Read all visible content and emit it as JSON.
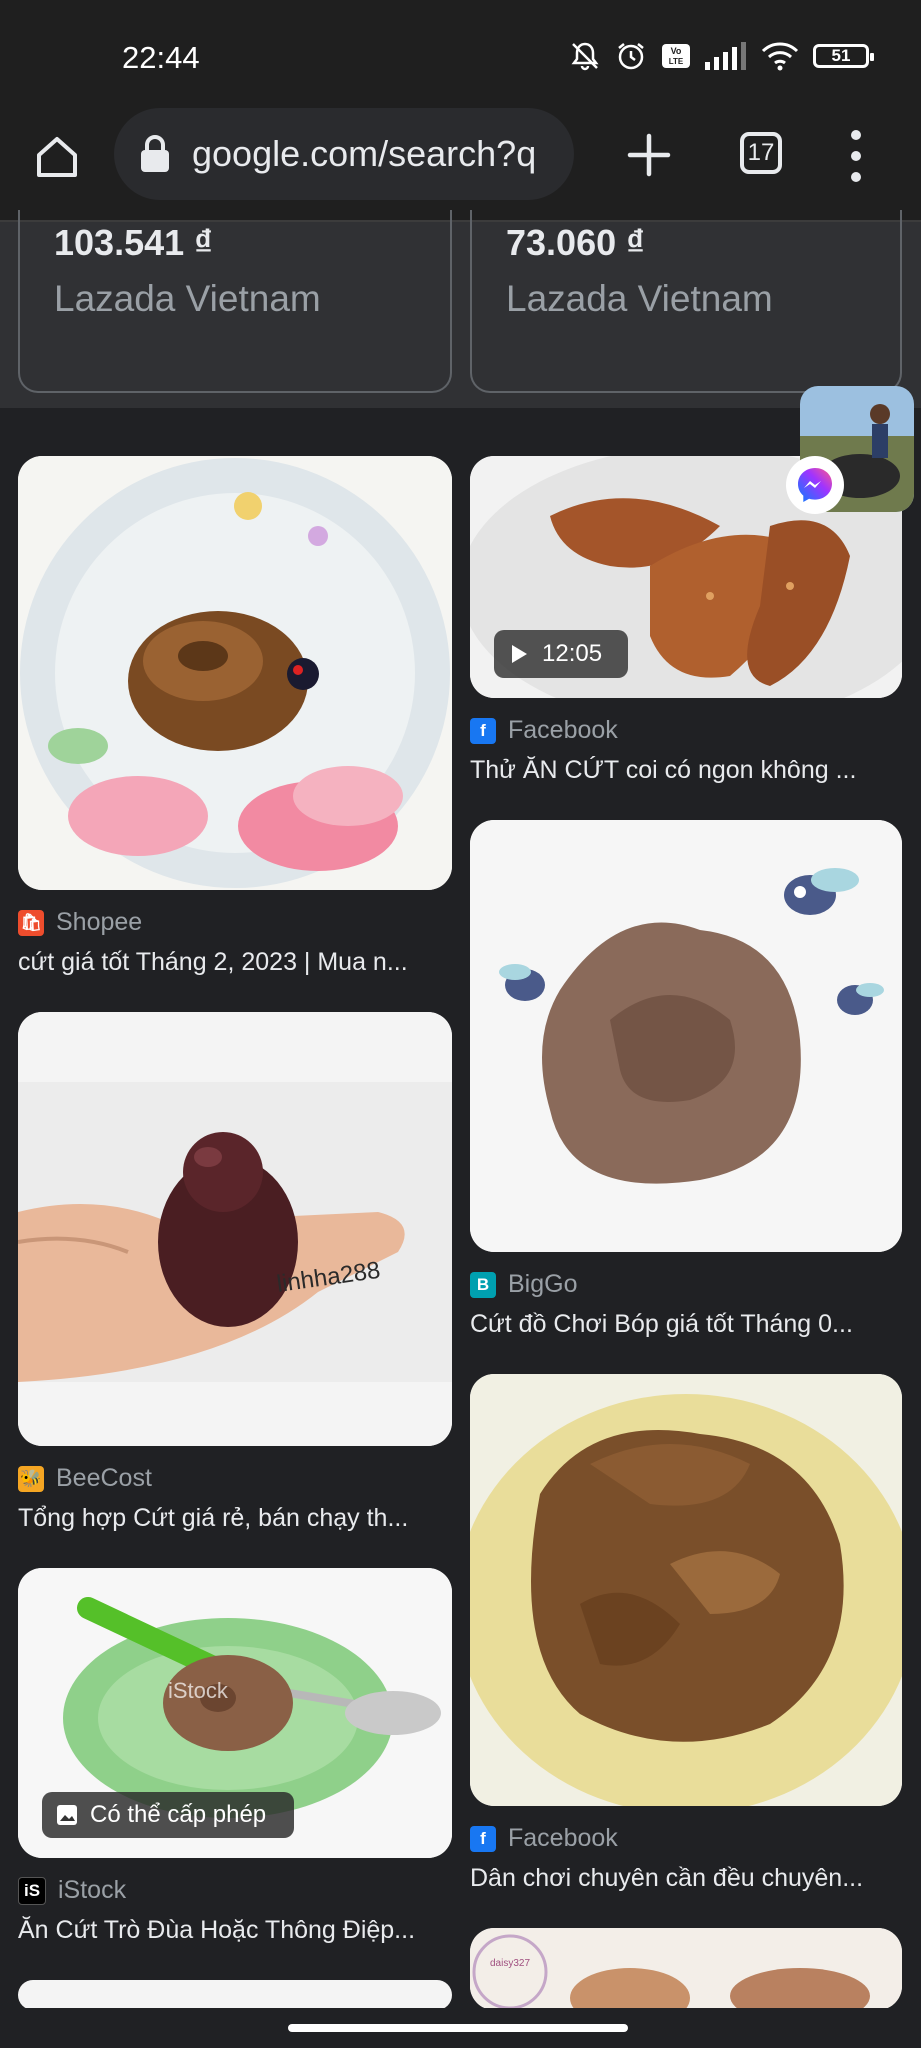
{
  "status_bar": {
    "time": "22:44",
    "battery": "51",
    "volte_label": "Vo LTE"
  },
  "browser": {
    "url": "google.com/search?q",
    "tab_count": "17"
  },
  "shopping": [
    {
      "price": "103.541 ₫",
      "merchant": "Lazada Vietnam"
    },
    {
      "price": "73.060 ₫",
      "merchant": "Lazada Vietnam"
    }
  ],
  "results": {
    "left": [
      {
        "source": "Shopee",
        "title": "cứt giá tốt Tháng 2, 2023 | Mua n...",
        "icon_color": "#ee4d2d"
      },
      {
        "source": "BeeCost",
        "title": "Tổng hợp Cứt giá rẻ, bán chạy th...",
        "icon_color": "#f5a623",
        "watermark": "linhha288"
      },
      {
        "source": "iStock",
        "title": "Ăn Cứt Trò Đùa Hoặc Thông Điệp...",
        "icon_color": "#000000",
        "icon_text": "iS",
        "badge": "Có thể cấp phép",
        "watermark": "iStock"
      }
    ],
    "right": [
      {
        "source": "Facebook",
        "title": "Thử ĂN CỨT coi có ngon không ...",
        "icon_color": "#1877f2",
        "duration": "12:05"
      },
      {
        "source": "BigGo",
        "title": "Cứt đồ Chơi Bóp giá tốt Tháng 0...",
        "icon_color": "#00a0b0",
        "icon_text": "B"
      },
      {
        "source": "Facebook",
        "title": "Dân chơi chuyên cần đều chuyên...",
        "icon_color": "#1877f2"
      }
    ],
    "partial_thumb_text": "daisy327"
  }
}
